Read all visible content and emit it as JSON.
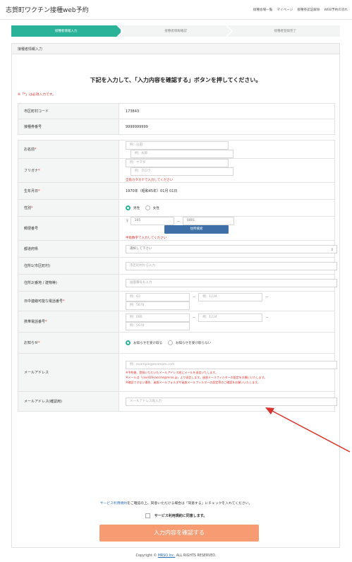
{
  "header": {
    "title": "志賀町ワクチン接種web予約",
    "nav": [
      "接種会場一覧",
      "マイページ",
      "接種券認証解除",
      "WEB予約の流れ"
    ]
  },
  "steps": [
    "接種者情報入力",
    "接種者情報確認",
    "接種者登録完了"
  ],
  "card_title": "接種者情報入力",
  "intro": "下記を入力して、「入力内容を確認する」ボタンを押してください。",
  "required_note": "※「*」は必須入力です。",
  "fields": {
    "municipality_code": {
      "label": "市区町村コード",
      "value": "173843"
    },
    "ticket_number": {
      "label": "接種券番号",
      "value": "9999999999"
    },
    "name": {
      "label": "お名前",
      "last_placeholder": "例：山田",
      "first_placeholder": "例：太郎"
    },
    "furigana": {
      "label": "フリガナ",
      "last_placeholder": "例：ヤマダ",
      "first_placeholder": "例：タロウ",
      "hint": "全角カタカナで入力してください"
    },
    "birthdate": {
      "label": "生年月日",
      "value": "1970年（昭和45年）01月 01日"
    },
    "gender": {
      "label": "性別",
      "options": [
        "男性",
        "女性"
      ],
      "selected": "男性"
    },
    "postal": {
      "label": "郵便番号",
      "prefix": "〒",
      "part1": "105",
      "part2": "0001",
      "hint": "半角数字で入力してください",
      "button": "住所検索"
    },
    "prefecture": {
      "label": "都道府県",
      "placeholder": "選択して下さい"
    },
    "address1": {
      "label": "住所1(市区町村)",
      "placeholder": "市区町村から入力"
    },
    "address2": {
      "label": "住所2(番地 / 建物等)",
      "placeholder": "画面番号も入力"
    },
    "daytime_phone": {
      "label": "日中連絡可能な電話番号",
      "p1": "例：03",
      "p2": "例：1234",
      "p3": "例：5678"
    },
    "mobile_phone": {
      "label": "携帯電話番号",
      "p1": "例：090",
      "p2": "例：1234",
      "p3": "例：5678"
    },
    "notifications": {
      "label": "お知らせ",
      "options": [
        "お知らせを受け取る",
        "お知らせを受け取らない"
      ],
      "selected": "お知らせを受け取る"
    },
    "email": {
      "label": "メールアドレス",
      "placeholder": "例：example@example.com",
      "notes": [
        "※予約後、登録いただいたメールアドレス宛にメールを送信いたします。",
        "※メールは「covid19vaccine@mrso.jp」より送信します。迷惑メールフィルターの設定をお願いいたします。",
        "※確認できない場合、迷惑メールフォルダや迷惑メールフィルターの設定等のご確認をお願いいたします。"
      ]
    },
    "email_confirm": {
      "label": "メールアドレス(確認用)",
      "placeholder": "メールアドレス再入力"
    }
  },
  "terms": {
    "link": "サービス利用規約",
    "text": "をご確認の上、同意いただける場合は「同意する」にチェックを入れてください。"
  },
  "agree_label": "サービス利用規約に同意します。",
  "submit_label": "入力内容を確認する",
  "footer": {
    "prefix": "Copyright © ",
    "company": "MRSO Inc.",
    "suffix": " ALL RIGHTS RESERVED."
  },
  "colors": {
    "accent": "#2bb39a",
    "submit": "#f79b73",
    "required": "#e0312e",
    "button": "#3f6fa7",
    "annotation_arrow": "#d8322c"
  }
}
